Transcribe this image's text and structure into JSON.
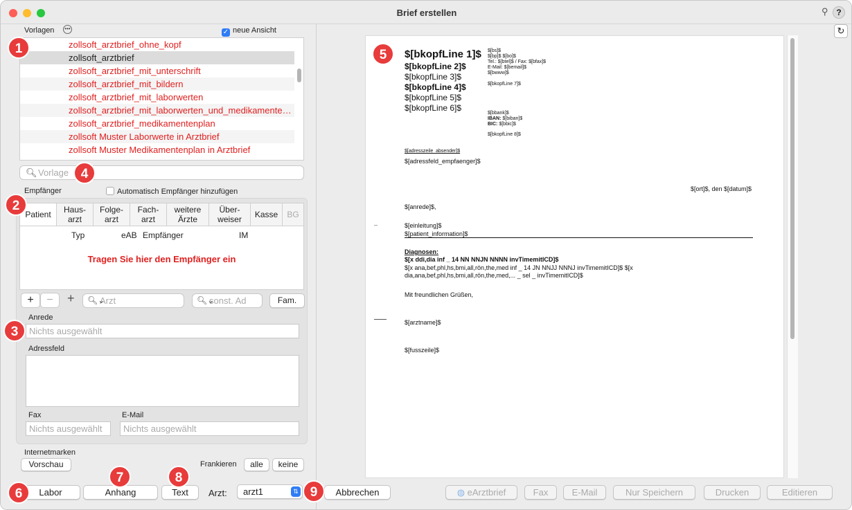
{
  "window": {
    "title": "Brief erstellen",
    "help": "?",
    "pin": "⚲"
  },
  "templates": {
    "label": "Vorlagen",
    "new_view": "neue Ansicht",
    "items": [
      {
        "label": "zollsoft_arztbrief_ohne_kopf"
      },
      {
        "label": "zollsoft_arztbrief"
      },
      {
        "label": "zollsoft_arztbrief_mit_unterschrift"
      },
      {
        "label": "zollsoft_arztbrief_mit_bildern"
      },
      {
        "label": "zollsoft_arztbrief_mit_laborwerten"
      },
      {
        "label": "zollsoft_arztbrief_mit_laborwerten_und_medikamentenplan"
      },
      {
        "label": "zollsoft_arztbrief_medikamentenplan"
      },
      {
        "label": "zollsoft Muster Laborwerte in Arztbrief"
      },
      {
        "label": "zollsoft Muster Medikamentenplan in Arztbrief"
      }
    ],
    "search_placeholder": "Vorlage"
  },
  "recipients": {
    "label": "Empfänger",
    "auto_add": "Automatisch Empfänger hinzufügen",
    "tabs": [
      "Patient",
      "Haus-\narzt",
      "Folge-\narzt",
      "Fach-\narzt",
      "weitere\nÄrzte",
      "Über-\nweiser",
      "Kasse",
      "BG"
    ],
    "columns": [
      "Typ",
      "eAB",
      "Empfänger",
      "IM"
    ],
    "hint": "Tragen Sie hier den Empfänger ein",
    "plus": "+",
    "minus": "−",
    "arzt_placeholder": "Arzt",
    "other_placeholder": "sonst. Ad",
    "fam": "Fam."
  },
  "form": {
    "anrede_label": "Anrede",
    "anrede_placeholder": "Nichts ausgewählt",
    "adressfeld_label": "Adressfeld",
    "fax_label": "Fax",
    "fax_placeholder": "Nichts ausgewählt",
    "email_label": "E-Mail",
    "email_placeholder": "Nichts ausgewählt"
  },
  "internetmarken": {
    "label": "Internetmarken",
    "preview": "Vorschau",
    "frankieren": "Frankieren",
    "all": "alle",
    "none": "keine"
  },
  "bottom": {
    "labor": "Labor",
    "anhang": "Anhang",
    "text": "Text",
    "arzt_label": "Arzt:",
    "arzt_value": "arzt1",
    "cancel": "Abbrechen",
    "earztbrief": "eArztbrief",
    "fax": "Fax",
    "email": "E-Mail",
    "save_only": "Nur Speichern",
    "print": "Drucken",
    "edit": "Editieren"
  },
  "preview": {
    "k1": "$[bkopfLine 1]$",
    "k2": "$[bkopfLine 2]$",
    "k3": "$[bkopfLine 3]$",
    "k4": "$[bkopfLine 4]$",
    "k5": "$[bkopfLine 5]$",
    "k6": "$[bkopfLine 6]$",
    "s1": "$[bs]$",
    "s2": "$[bp]$ $[bo]$",
    "s3": "Tel.: $[btel]$ / Fax: $[bfax]$",
    "s4": "E-Mail: $[bemail]$",
    "s5": "$[bwww]$",
    "s6": "$[bkopfLine 7]$",
    "b1": "$[bbank]$",
    "b2_label": "IBAN:",
    "b2_value": "$[biban]$",
    "b3_label": "BIC:",
    "b3_value": "$[bbic]$",
    "b4": "$[bkopfLine 8]$",
    "sender": "$[adresszeile_absender]$",
    "recipient": "$[adressfeld_empfaenger]$",
    "place_date": "$[ort]$, den $[datum]$",
    "salutation": "$[anrede]$,",
    "intro": "$[einleitung]$",
    "patient_info": "$[patient_information]$",
    "diag_title": "Diagnosen:",
    "diag1": "$[x ddi,dia inf _ 14 NN NNJN NNNN invTimemitICD]$",
    "diag2": "$[x ana,bef,phl,hs,bmi,all,rön,the,med inf _ 14 JN NNJJ NNNJ invTimemitICD]$ $[x",
    "diag3": "dia,ana,bef,phl,hs,bmi,all,rön,the,med,... _ sel _ invTimemitICD]$",
    "closing": "Mit freundlichen Grüßen,",
    "doctor": "$[arztname]$",
    "footer": "$[fusszeile]$"
  },
  "badges": [
    "1",
    "2",
    "3",
    "4",
    "5",
    "6",
    "7",
    "8",
    "9"
  ],
  "colors": {
    "accent": "#2f7df6",
    "red": "#e02020",
    "badge": "#e83b3b"
  }
}
